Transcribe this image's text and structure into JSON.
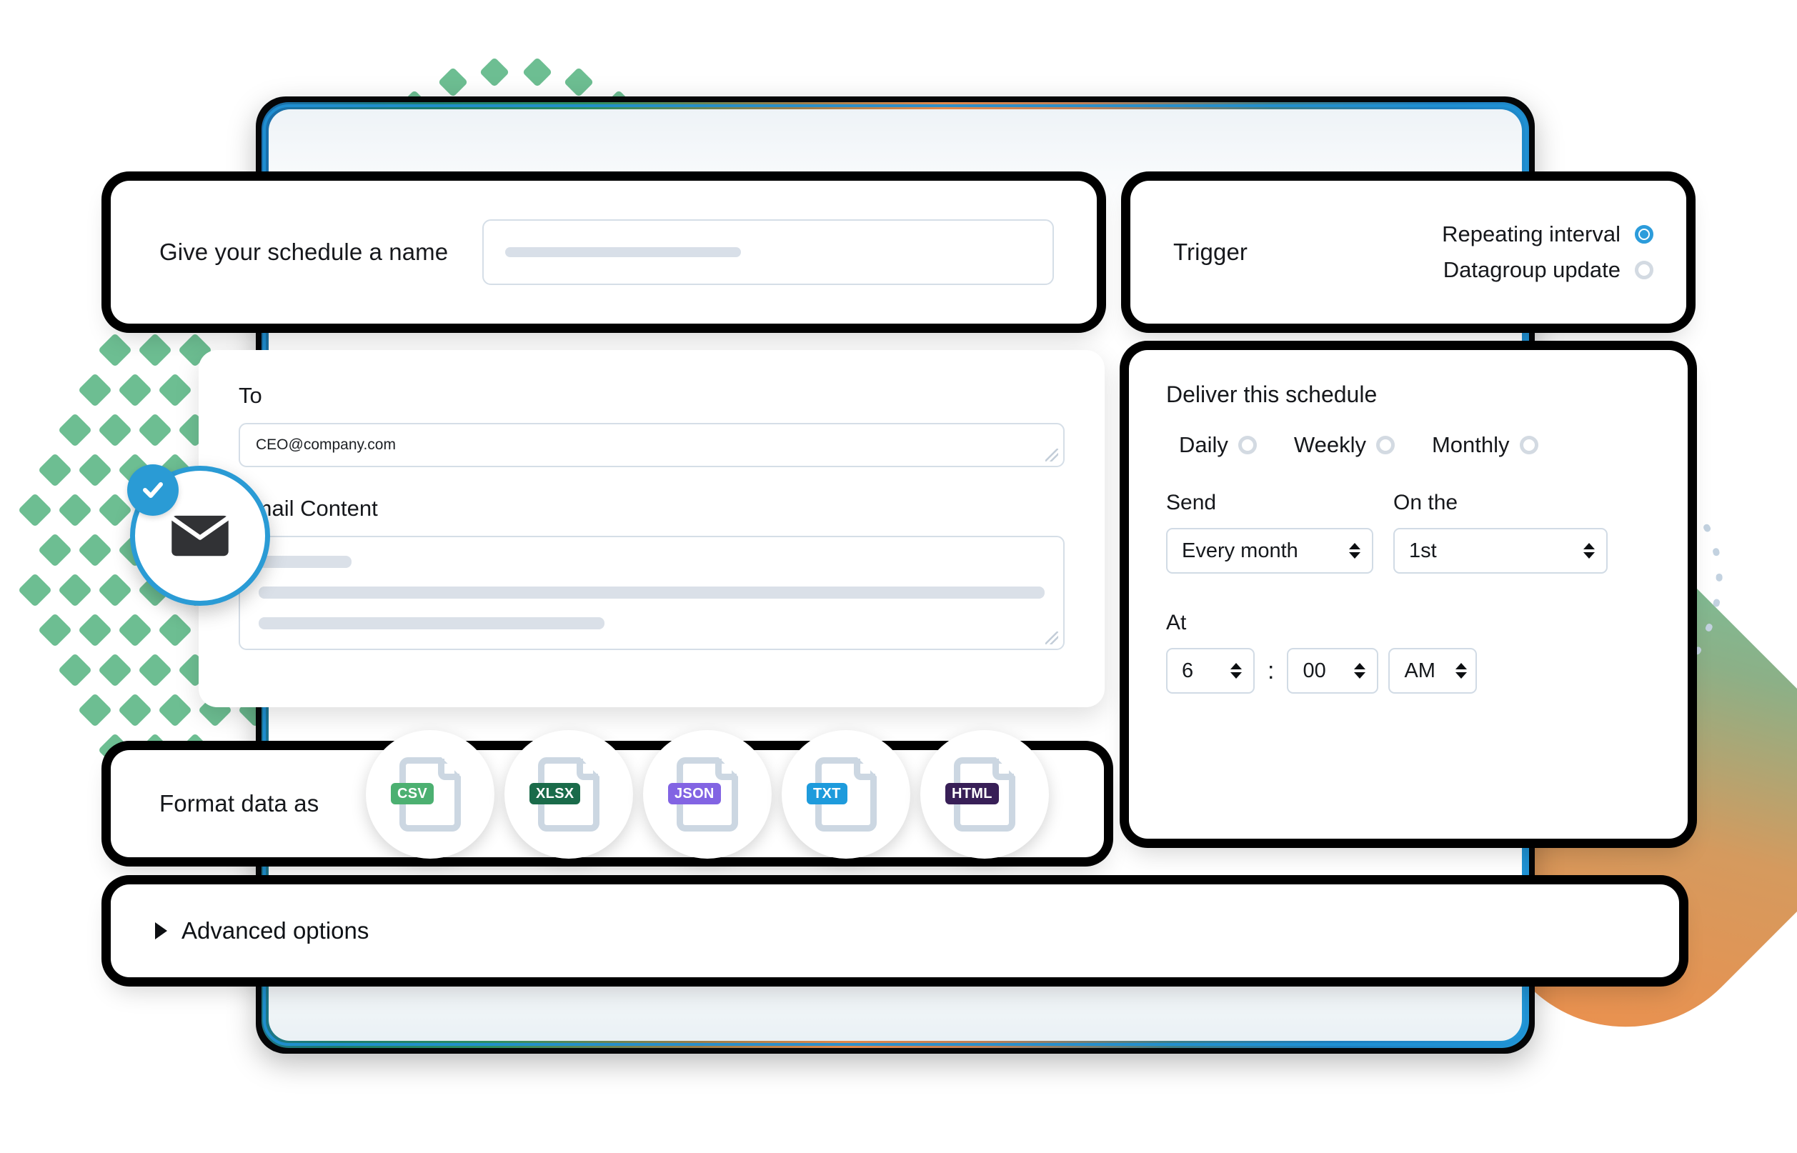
{
  "schedule_name": {
    "label": "Give your schedule a name",
    "value": ""
  },
  "trigger": {
    "label": "Trigger",
    "options": [
      {
        "label": "Repeating interval",
        "selected": true
      },
      {
        "label": "Datagroup update",
        "selected": false
      }
    ]
  },
  "email": {
    "to_label": "To",
    "to_value": "CEO@company.com",
    "content_label": "Email Content",
    "content_value": ""
  },
  "deliver": {
    "title": "Deliver this schedule",
    "frequencies": [
      {
        "label": "Daily",
        "selected": false
      },
      {
        "label": "Weekly",
        "selected": false
      },
      {
        "label": "Monthly",
        "selected": false
      }
    ],
    "send_label": "Send",
    "send_value": "Every month",
    "onthe_label": "On the",
    "onthe_value": "1st",
    "at_label": "At",
    "hour_value": "6",
    "time_separator": ":",
    "minute_value": "00",
    "meridiem_value": "AM"
  },
  "format": {
    "label": "Format data as",
    "options": [
      {
        "label": "CSV",
        "color": "#4CB071"
      },
      {
        "label": "XLSX",
        "color": "#1A6B4A"
      },
      {
        "label": "JSON",
        "color": "#8264E3"
      },
      {
        "label": "TXT",
        "color": "#1E9BDC"
      },
      {
        "label": "HTML",
        "color": "#381F57"
      }
    ]
  },
  "advanced": {
    "label": "Advanced options"
  },
  "icons": {
    "mail": "mail-icon",
    "check": "check-icon",
    "disclosure": "disclosure-triangle-icon"
  },
  "theme": {
    "accent_blue": "#2C9CDB",
    "frame_blue": "#2090D4",
    "deco_green": "#6DBE92",
    "deco_orange": "#EE8F4C",
    "input_border": "#D5DEE7",
    "placeholder_bar": "#D8DFE8"
  }
}
